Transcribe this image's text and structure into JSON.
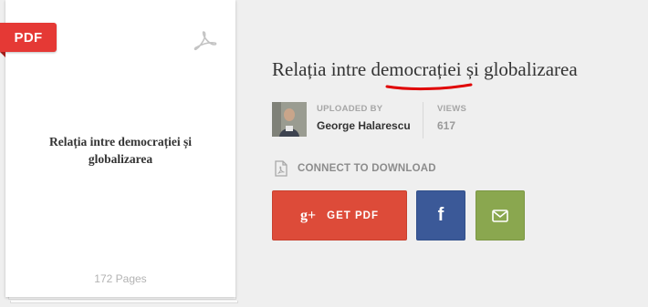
{
  "document": {
    "badge": "PDF",
    "title": "Relația intre democrației și globalizarea",
    "pages": "172 Pages",
    "icon": "acrobat-icon"
  },
  "header": {
    "title": "Relația intre democrației și globalizarea"
  },
  "meta": {
    "uploaded_label": "UPLOADED BY",
    "uploader": "George Halarescu",
    "views_label": "VIEWS",
    "views": "617"
  },
  "connect": {
    "text": "CONNECT TO DOWNLOAD",
    "icon": "pdf-file-icon"
  },
  "actions": {
    "get_pdf": "GET PDF",
    "gplus_glyph": "g+",
    "facebook_glyph": "f",
    "mail_icon": "envelope-icon"
  },
  "colors": {
    "pdf_badge": "#e53935",
    "get_pdf": "#dd4b39",
    "facebook": "#3b5998",
    "mail": "#8aa74f",
    "annotation": "#e00000",
    "uploader": "#333333",
    "views": "#9a9a9a"
  }
}
